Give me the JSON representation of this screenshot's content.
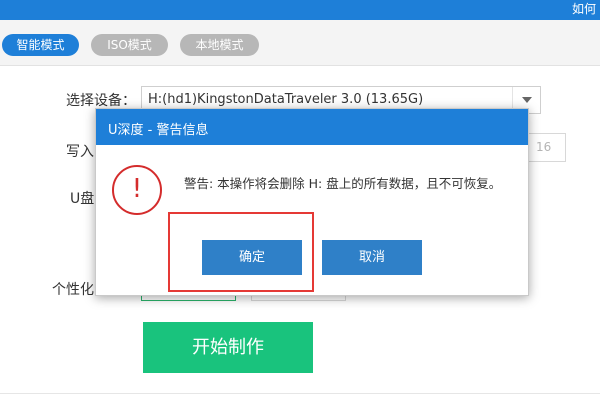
{
  "window": {
    "title": "如何"
  },
  "tabs": [
    {
      "label": "智能模式",
      "active": true
    },
    {
      "label": "ISO模式",
      "active": false
    },
    {
      "label": "本地模式",
      "active": false
    }
  ],
  "form": {
    "device_label": "选择设备：",
    "device_value": "H:(hd1)KingstonDataTraveler 3.0 (13.65G)",
    "write_label": "写入",
    "write_value": "16",
    "usb_label": "U盘",
    "personal_label": "个性化"
  },
  "start_button": {
    "label": "开始制作"
  },
  "dialog": {
    "title": "U深度 - 警告信息",
    "icon": "!",
    "message": "警告: 本操作将会删除 H: 盘上的所有数据，且不可恢复。",
    "confirm_label": "确定",
    "cancel_label": "取消"
  },
  "colors": {
    "accent": "#1e7fd8",
    "start_button": "#19c37d",
    "warning": "#d42c2c",
    "highlight": "#e53935"
  }
}
